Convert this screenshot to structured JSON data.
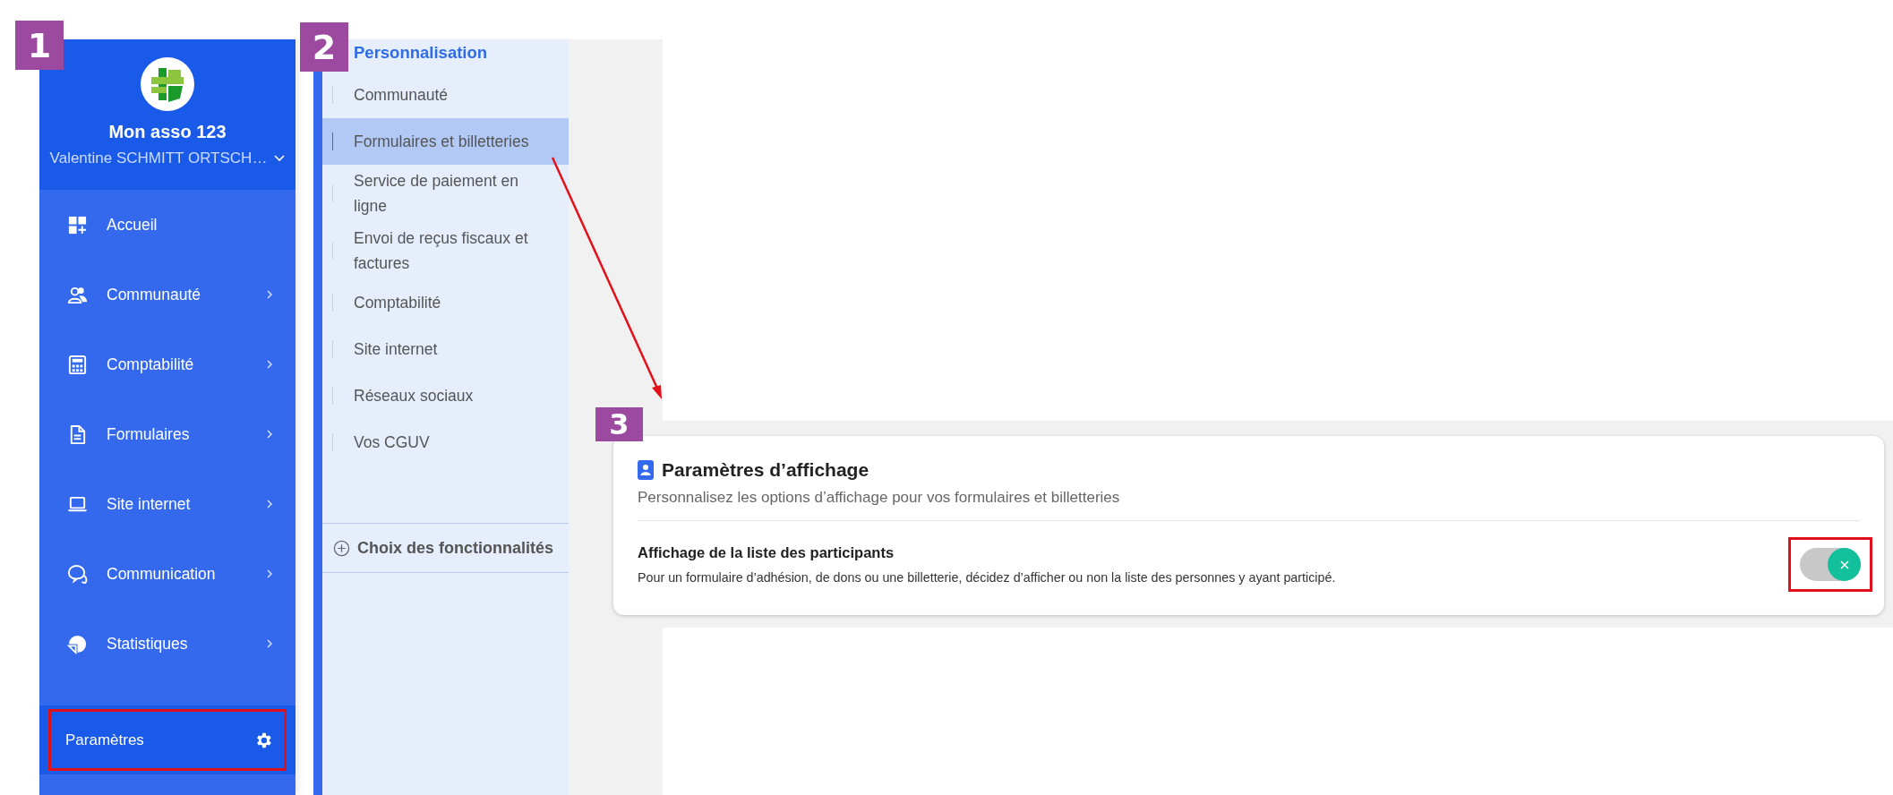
{
  "annotations": {
    "badges": [
      "1",
      "2",
      "3"
    ]
  },
  "sidebar": {
    "org_name": "Mon asso 123",
    "user_name": "Valentine SCHMITT ORTSCH…",
    "items": [
      {
        "label": "Accueil",
        "has_submenu": false
      },
      {
        "label": "Communauté",
        "has_submenu": true
      },
      {
        "label": "Comptabilité",
        "has_submenu": true
      },
      {
        "label": "Formulaires",
        "has_submenu": true
      },
      {
        "label": "Site internet",
        "has_submenu": true
      },
      {
        "label": "Communication",
        "has_submenu": true
      },
      {
        "label": "Statistiques",
        "has_submenu": true
      }
    ],
    "settings": {
      "label": "Paramètres",
      "highlighted": true
    }
  },
  "settings_menu": {
    "title": "Personnalisation",
    "items": [
      {
        "label": "Communauté",
        "selected": false
      },
      {
        "label": "Formulaires et billetteries",
        "selected": true
      },
      {
        "label": "Service de paiement en ligne",
        "selected": false
      },
      {
        "label": "Envoi de reçus fiscaux et factures",
        "selected": false
      },
      {
        "label": "Comptabilité",
        "selected": false
      },
      {
        "label": "Site internet",
        "selected": false
      },
      {
        "label": "Réseaux sociaux",
        "selected": false
      },
      {
        "label": "Vos CGUV",
        "selected": false
      }
    ],
    "footer": "Choix des fonctionnalités"
  },
  "display_settings": {
    "title": "Paramètres d’affichage",
    "subtitle": "Personnalisez les options d’affichage pour vos formulaires et billetteries",
    "options": [
      {
        "title": "Affichage de la liste des participants",
        "description": "Pour un formulaire d’adhésion, de dons ou une billetterie, décidez d’afficher ou non la liste des personnes y ayant participé.",
        "on": true,
        "highlighted": true
      }
    ]
  }
}
